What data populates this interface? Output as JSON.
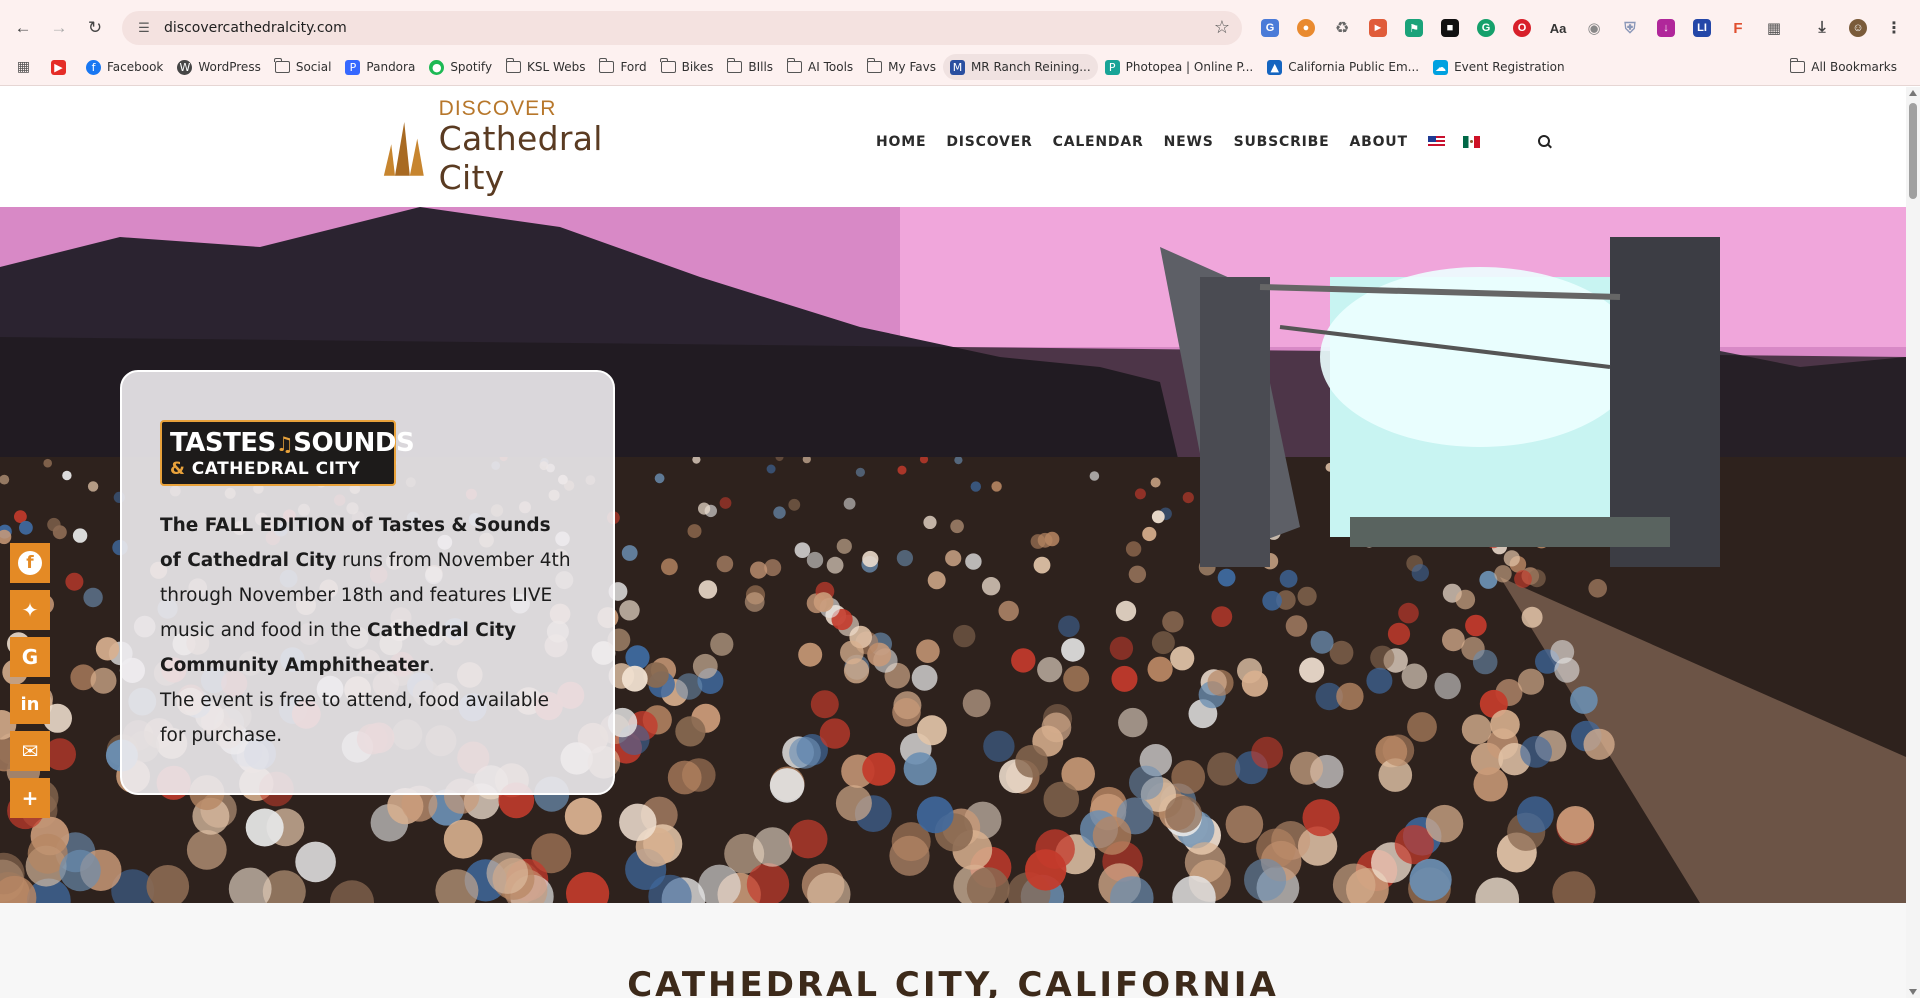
{
  "browser": {
    "url": "discovercathedralcity.com",
    "bookmarks": [
      {
        "label": "",
        "kind": "youtube"
      },
      {
        "label": "Facebook",
        "kind": "facebook"
      },
      {
        "label": "WordPress",
        "kind": "wordpress"
      },
      {
        "label": "Social",
        "kind": "folder"
      },
      {
        "label": "Pandora",
        "kind": "pandora"
      },
      {
        "label": "Spotify",
        "kind": "spotify"
      },
      {
        "label": "KSL Webs",
        "kind": "folder"
      },
      {
        "label": "Ford",
        "kind": "folder"
      },
      {
        "label": "Bikes",
        "kind": "folder"
      },
      {
        "label": "BIlls",
        "kind": "folder"
      },
      {
        "label": "AI Tools",
        "kind": "folder"
      },
      {
        "label": "My Favs",
        "kind": "folder"
      },
      {
        "label": "MR Ranch Reining...",
        "kind": "mr"
      },
      {
        "label": "Photopea | Online P...",
        "kind": "photopea"
      },
      {
        "label": "California Public Em...",
        "kind": "calpers"
      },
      {
        "label": "Event Registration",
        "kind": "salesforce"
      }
    ],
    "all_bookmarks": "All Bookmarks",
    "colors": {
      "chrome_bg": "#fdf1f0",
      "omnibox_bg": "#f4e2e0"
    }
  },
  "site": {
    "logo_small": "DISCOVER",
    "logo_big": "Cathedral City",
    "nav": [
      "HOME",
      "DISCOVER",
      "CALENDAR",
      "NEWS",
      "SUBSCRIBE",
      "ABOUT"
    ],
    "colors": {
      "accent": "#e48a25",
      "brand_brown": "#5a3b22",
      "brand_gold": "#b7772b"
    }
  },
  "hero_card": {
    "logo_line1_a": "TASTES",
    "logo_line1_b": "SOUNDS",
    "logo_line2": "CATHEDRAL CITY",
    "p1_bold1": "The FALL EDITION of Tastes & Sounds of Cathedral City",
    "p1_text1": " runs from November 4th through November 18th and features LIVE music and food in the ",
    "p1_bold2": "Cathedral City Community Amphitheater",
    "p1_text2": ".",
    "p2": "The event is free to attend, food available for purchase."
  },
  "share_buttons": [
    "facebook-icon",
    "twitter-icon",
    "google-icon",
    "linkedin-icon",
    "email-icon",
    "plus-icon"
  ],
  "section_title": "CATHEDRAL CITY, CALIFORNIA"
}
